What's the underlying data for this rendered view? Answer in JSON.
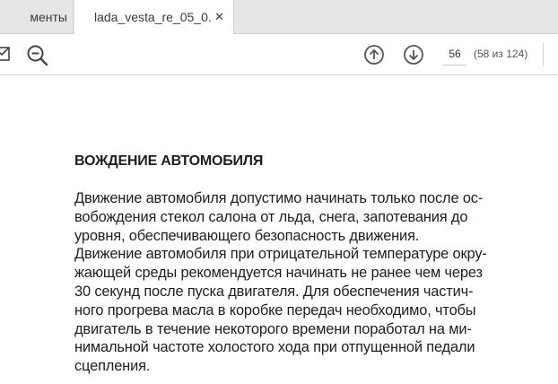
{
  "tabs": {
    "prev_label": "менты",
    "active_label": "lada_vesta_re_05_0...",
    "close_glyph": "✕"
  },
  "toolbar": {
    "page_current": "56",
    "page_count": "(58 из 124)"
  },
  "document": {
    "heading": "ВОЖДЕНИЕ АВТОМОБИЛЯ",
    "lines": [
      "Движение автомобиля допустимо начинать только после ос-",
      "вобождения стекол салона от льда, снега, запотевания до",
      "уровня, обеспечивающего безопасность движения.",
      "Движение автомобиля при отрицательной температуре окру-",
      "жающей среды рекомендуется начинать не ранее чем через",
      "30 секунд после пуска двигателя. Для обеспечения частич-",
      "ного прогрева масла в коробке передач необходимо, чтобы",
      "двигатель в течение некоторого времени поработал на ми-",
      "нимальной частоте холостого хода при отпущенной педали",
      "сцепления."
    ]
  },
  "icons": {
    "toolbar_left": "mail-icon",
    "zoom": "zoom-out-icon",
    "prev_page": "arrow-up-circle-icon",
    "next_page": "arrow-down-circle-icon"
  }
}
